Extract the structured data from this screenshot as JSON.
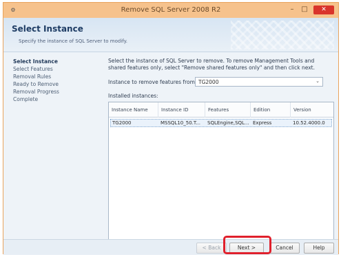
{
  "window": {
    "title": "Remove SQL Server 2008 R2",
    "controls": {
      "minimize": "–",
      "maximize": "□",
      "close": "✕"
    }
  },
  "header": {
    "title": "Select Instance",
    "subtitle": "Specify the instance of SQL Server to modify."
  },
  "sidebar": {
    "items": [
      {
        "label": "Select Instance",
        "active": true
      },
      {
        "label": "Select Features",
        "active": false
      },
      {
        "label": "Removal Rules",
        "active": false
      },
      {
        "label": "Ready to Remove",
        "active": false
      },
      {
        "label": "Removal Progress",
        "active": false
      },
      {
        "label": "Complete",
        "active": false
      }
    ]
  },
  "main": {
    "instructions": "Select the instance of SQL Server to remove. To remove Management Tools and shared features only, select \"Remove shared features only\" and then click next.",
    "remove_from_label": "Instance to remove features from:",
    "remove_from_value": "TG2000",
    "installed_label": "Installed instances:",
    "table": {
      "columns": [
        "Instance Name",
        "Instance ID",
        "Features",
        "Edition",
        "Version"
      ],
      "rows": [
        [
          "TG2000",
          "MSSQL10_50.T...",
          "SQLEngine,SQL...",
          "Express",
          "10.52.4000.0"
        ]
      ]
    }
  },
  "footer": {
    "back": "< Back",
    "next": "Next >",
    "cancel": "Cancel",
    "help": "Help"
  },
  "colors": {
    "titlebar": "#f6c28c",
    "close_button": "#d9342b",
    "highlight": "#e0202c"
  },
  "icons": {
    "app": "sql-server-setup-icon",
    "dropdown": "chevron-down-icon"
  }
}
